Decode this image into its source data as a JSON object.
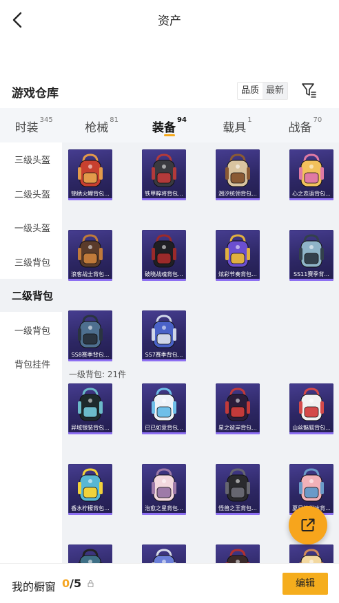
{
  "header": {
    "title": "资产"
  },
  "warehouse": {
    "title": "游戏仓库",
    "sort_options": [
      "品质",
      "最新"
    ],
    "active_sort": "品质"
  },
  "tabs": [
    {
      "label": "时装",
      "count": "345"
    },
    {
      "label": "枪械",
      "count": "81"
    },
    {
      "label": "装备",
      "count": "94",
      "active": true
    },
    {
      "label": "载具",
      "count": "1"
    },
    {
      "label": "战备",
      "count": "70"
    }
  ],
  "sidebar": {
    "items": [
      "三级头盔",
      "二级头盔",
      "一级头盔",
      "三级背包",
      "二级背包",
      "一级背包",
      "背包挂件"
    ],
    "active": "二级背包"
  },
  "sections": {
    "level2_items": [
      {
        "name": "锦绣火鲤背包...",
        "icon": "koi-backpack-icon"
      },
      {
        "name": "铁甲粹将背包...",
        "icon": "armor-backpack-icon"
      },
      {
        "name": "潮汐统领背包...",
        "icon": "tide-backpack-icon"
      },
      {
        "name": "心之恋语背包...",
        "icon": "star-backpack-icon"
      },
      {
        "name": "浪客战士背包...",
        "icon": "ronin-backpack-icon"
      },
      {
        "name": "破晓战魂背包...",
        "icon": "dawn-backpack-icon"
      },
      {
        "name": "炫彩节奏背包...",
        "icon": "rhythm-backpack-icon"
      },
      {
        "name": "SS11赛季背...",
        "icon": "ss11-backpack-icon"
      },
      {
        "name": "SS8赛季背包...",
        "icon": "ss8-backpack-icon"
      },
      {
        "name": "SS7赛季背包...",
        "icon": "ss7-backpack-icon"
      }
    ],
    "level1_label": "一级背包: 21件",
    "level1_items": [
      {
        "name": "异域银装背包...",
        "icon": "exotic-backpack-icon"
      },
      {
        "name": "已已如意背包...",
        "icon": "bunny-backpack-icon"
      },
      {
        "name": "星之彼岸背包...",
        "icon": "star-shore-backpack-icon"
      },
      {
        "name": "山丝魅狐背包...",
        "icon": "fox-backpack-icon"
      },
      {
        "name": "香水柠檬背包...",
        "icon": "lemon-backpack-icon"
      },
      {
        "name": "治愈之星背包...",
        "icon": "healing-star-backpack-icon"
      },
      {
        "name": "怪兽之王背包...",
        "icon": "monster-backpack-icon"
      },
      {
        "name": "夏日缤纷冰背...",
        "icon": "summer-backpack-icon"
      },
      {
        "name": "",
        "icon": "backpack-icon"
      },
      {
        "name": "",
        "icon": "backpack-icon"
      },
      {
        "name": "",
        "icon": "backpack-icon"
      },
      {
        "name": "",
        "icon": "backpack-icon"
      }
    ]
  },
  "bottom": {
    "showcase_label": "我的橱窗",
    "showcase_current": "0",
    "showcase_total": "/5",
    "edit_label": "编辑"
  },
  "colors": {
    "accent": "#f5ad1d",
    "item_bg": "#2d2764",
    "item_stripe": "#8d6ff2",
    "content_bg": "#f0f2f5"
  }
}
